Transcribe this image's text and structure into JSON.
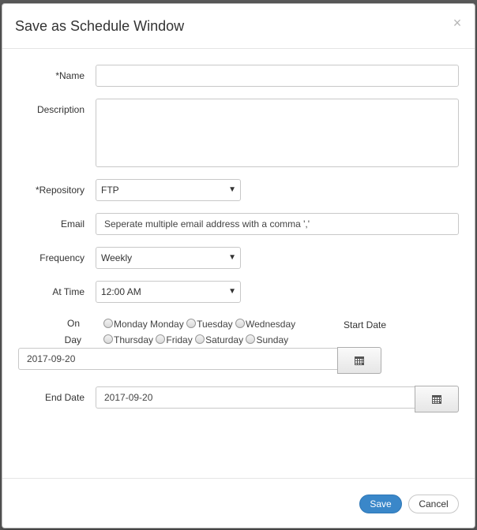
{
  "dialog": {
    "title": "Save as Schedule Window",
    "close_glyph": "×"
  },
  "form": {
    "name": {
      "label": "*Name",
      "value": ""
    },
    "description": {
      "label": "Description",
      "value": ""
    },
    "repository": {
      "label": "*Repository",
      "selected": "FTP"
    },
    "email": {
      "label": "Email",
      "placeholder": "Seperate multiple email address with a comma ','"
    },
    "frequency": {
      "label": "Frequency",
      "selected": "Weekly"
    },
    "at_time": {
      "label": "At Time",
      "selected": "12:00 AM"
    },
    "on_day": {
      "label_line1": "On",
      "label_line2": "Day",
      "options_row1": [
        "Monday Monday",
        "Tuesday",
        "Wednesday"
      ],
      "options_row2": [
        "Thursday",
        "Friday",
        "Saturday",
        "Sunday"
      ]
    },
    "start_date": {
      "label": "Start Date",
      "value": "2017-09-20"
    },
    "end_date": {
      "label": "End Date",
      "value": "2017-09-20"
    }
  },
  "icons": {
    "dropdown": "caret-down-icon",
    "calendar": "calendar-icon",
    "radio": "radio-icon",
    "close": "close-icon"
  },
  "footer": {
    "save_label": "Save",
    "cancel_label": "Cancel"
  },
  "colors": {
    "primary": "#3a87c9",
    "overlay": "#5a5a5a"
  }
}
